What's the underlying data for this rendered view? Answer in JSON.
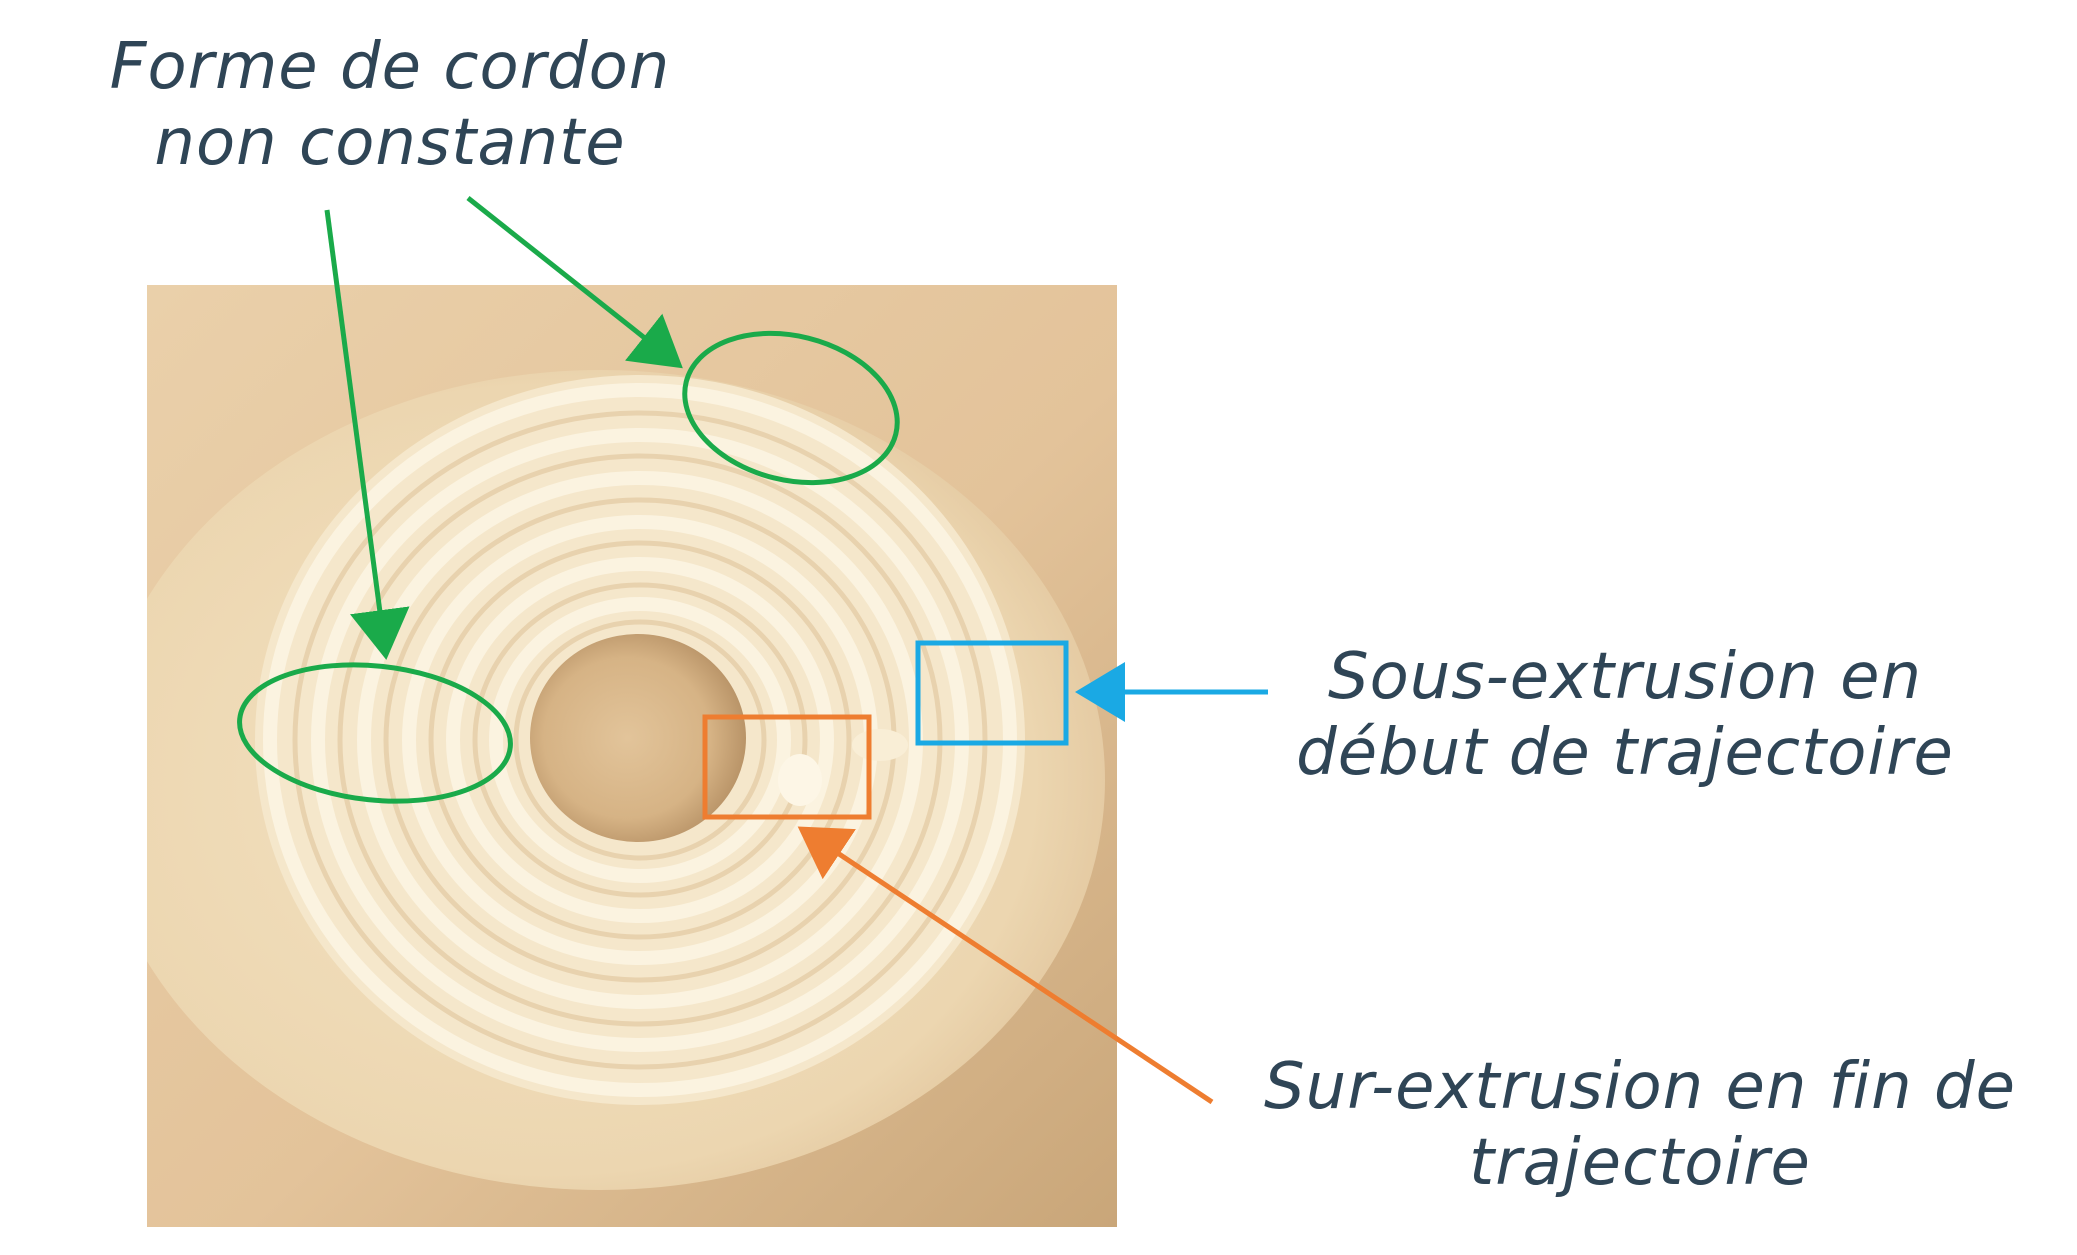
{
  "annotations": {
    "green": {
      "line1": "Forme de cordon",
      "line2": "non constante",
      "color": "#1aaa4a"
    },
    "blue": {
      "line1": "Sous-extrusion en",
      "line2": "début de trajectoire",
      "color": "#1aa9e4"
    },
    "orange": {
      "line1": "Sur-extrusion en fin de",
      "line2": "trajectoire",
      "color": "#ee7d30"
    }
  },
  "photo": {
    "subject": "spiral-bead-print",
    "background_color": "#e6c8a0",
    "bead_color": "#f6ebd2"
  }
}
